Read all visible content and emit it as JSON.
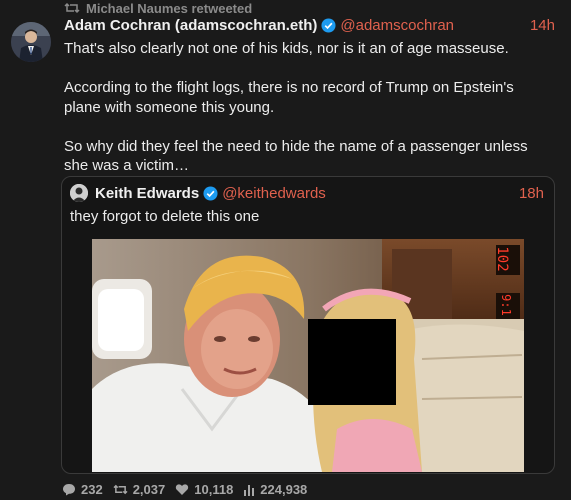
{
  "retweet": {
    "label": "Michael Naumes retweeted",
    "icon": "retweet-icon"
  },
  "tweet": {
    "author_name": "Adam Cochran (adamscochran.eth)",
    "handle": "@adamscochran",
    "time": "14h",
    "paragraphs": [
      "That's also clearly not one of his kids, nor is it an of age masseuse.",
      "According to the flight logs, there is no record of Trump on Epstein's plane with someone this young.",
      "So why did they feel the need to hide the name of a passenger unless she was a victim…"
    ]
  },
  "quote": {
    "author_name": "Keith Edwards",
    "handle": "@keithedwards",
    "time": "18h",
    "text": "they forgot to delete this one"
  },
  "stats": {
    "replies": "232",
    "retweets": "2,037",
    "likes": "10,118",
    "views": "224,938"
  },
  "colors": {
    "accent": "#e0614e",
    "verified": "#1d9bf0",
    "background": "#1a1a1a"
  }
}
